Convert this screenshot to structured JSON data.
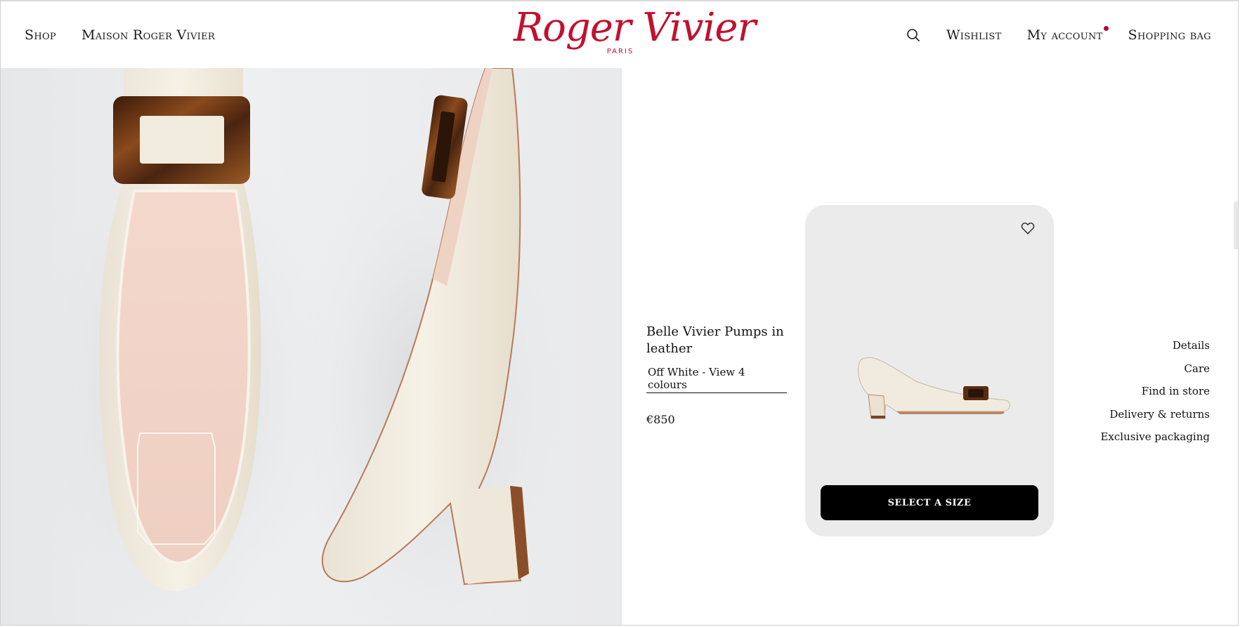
{
  "header": {
    "nav_left": [
      "Shop",
      "Maison Roger Vivier"
    ],
    "logo_text": "Roger Vivier",
    "logo_sub": "PARIS",
    "wishlist": "Wishlist",
    "account": "My account",
    "bag": "Shopping bag",
    "search_icon": "search-icon",
    "brand_color": "#c2102f"
  },
  "product": {
    "title": "Belle Vivier Pumps in leather",
    "colour_link": "Off White - View 4 colours",
    "price": "€850",
    "cta": "SELECT A SIZE",
    "wishlist_icon": "heart-outline-icon"
  },
  "side_links": [
    "Details",
    "Care",
    "Find in store",
    "Delivery & returns",
    "Exclusive packaging"
  ],
  "colors": {
    "card_bg": "#ebebeb",
    "cta_bg": "#000000",
    "shoe_leather": "#f1ebdf",
    "tortoise": "#5a2c12"
  }
}
